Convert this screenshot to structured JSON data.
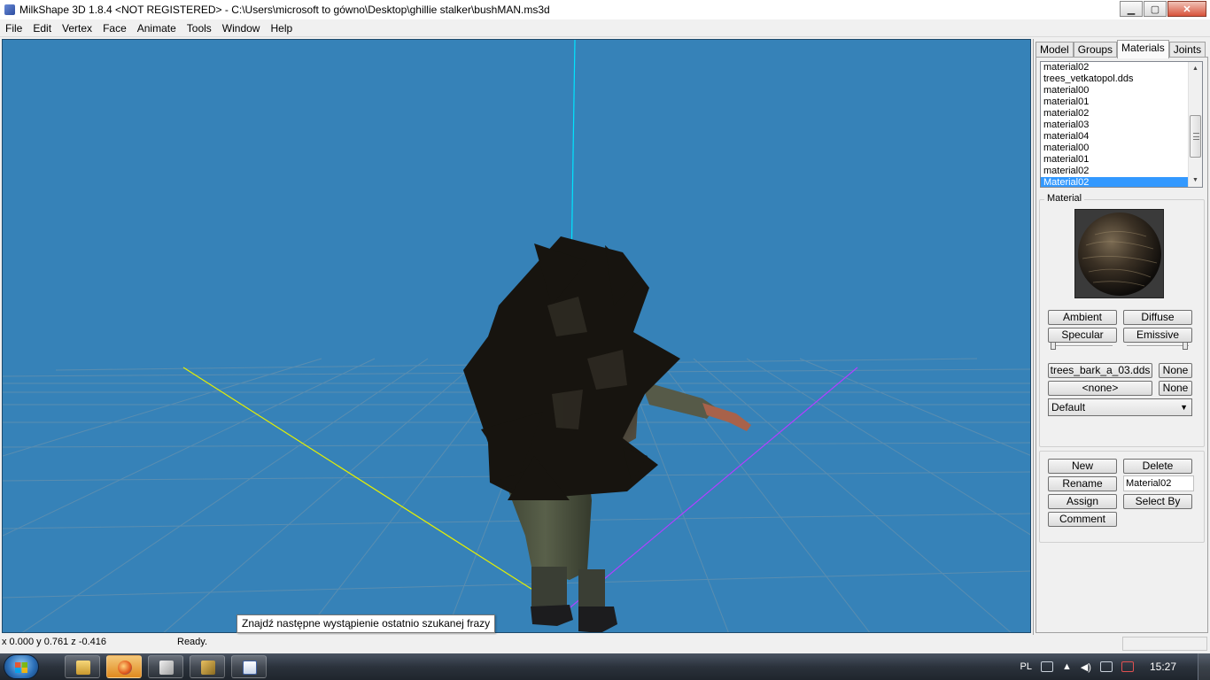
{
  "window": {
    "title": "MilkShape 3D 1.8.4 <NOT REGISTERED> - C:\\Users\\microsoft to gówno\\Desktop\\ghillie stalker\\bushMAN.ms3d",
    "buttons": {
      "minimize": "▁",
      "maximize": "▢",
      "close": "✕"
    }
  },
  "menu": [
    "File",
    "Edit",
    "Vertex",
    "Face",
    "Animate",
    "Tools",
    "Window",
    "Help"
  ],
  "tooltip": "Znajdź następne wystąpienie ostatnio szukanej frazy",
  "panel": {
    "tabs": [
      "Model",
      "Groups",
      "Materials",
      "Joints"
    ],
    "active_tab": "Materials",
    "materials": [
      "material02",
      "trees_vetkatopol.dds",
      "material00",
      "material01",
      "material02",
      "material03",
      "material04",
      "material00",
      "material01",
      "material02",
      "Material02"
    ],
    "selected_index": 10,
    "material_group_label": "Material",
    "buttons": {
      "ambient": "Ambient",
      "diffuse": "Diffuse",
      "specular": "Specular",
      "emissive": "Emissive",
      "texture": "trees_bark_a_03.dds",
      "texture_none": "None",
      "alpha": "<none>",
      "alpha_none": "None",
      "new": "New",
      "delete": "Delete",
      "rename": "Rename",
      "assign": "Assign",
      "select_by": "Select By",
      "comment": "Comment"
    },
    "mode_select": "Default",
    "name_field": "Material02"
  },
  "status": {
    "coords": "x 0.000 y 0.761 z -0.416",
    "text": "Ready."
  },
  "taskbar": {
    "language": "PL",
    "clock": "15:27"
  },
  "colors": {
    "viewport_bg": "#3682b8",
    "grid": "#5e8fb0",
    "axis_y": "#00e5ff",
    "axis_x": "#e6f000",
    "axis_z": "#b040ff",
    "selection": "#3399ff"
  }
}
